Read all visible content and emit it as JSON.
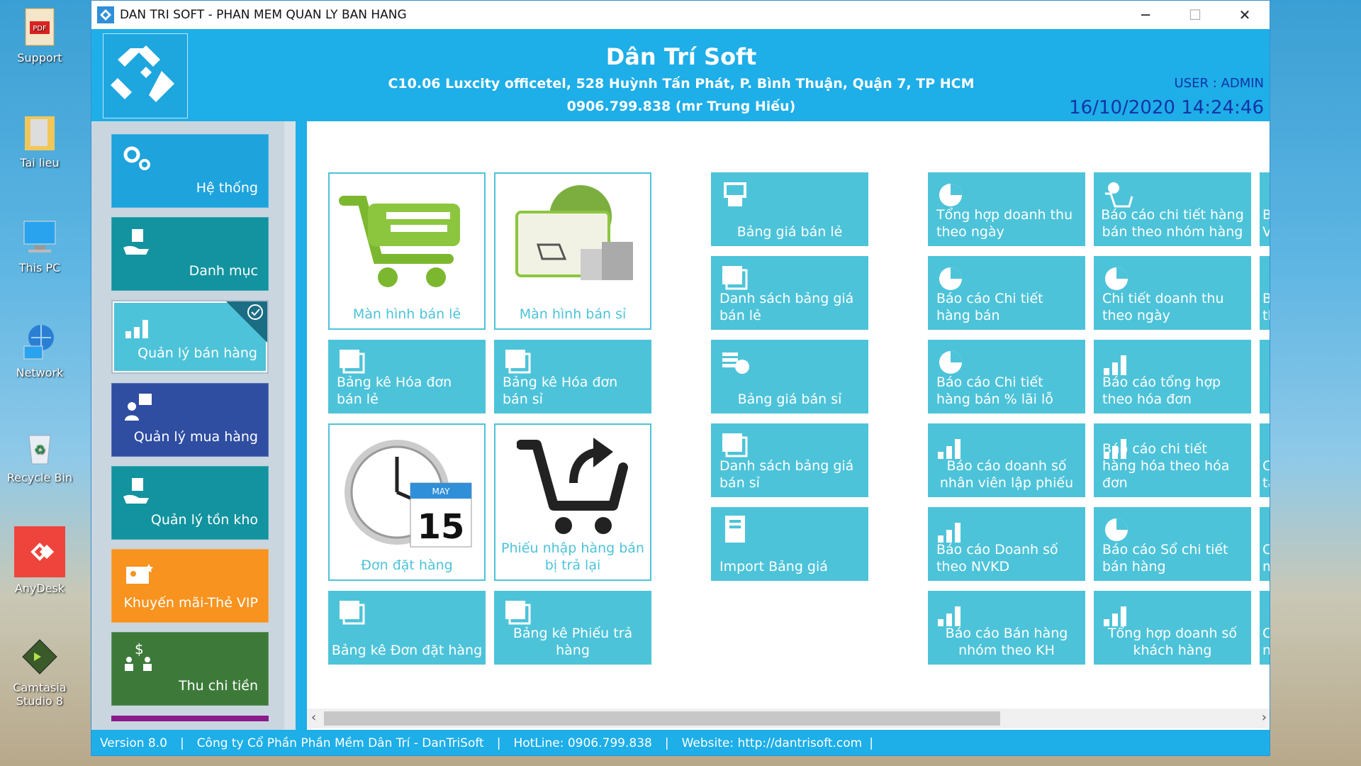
{
  "desktop": {
    "icons": [
      {
        "label": "Support",
        "icon": "pdf-file-icon"
      },
      {
        "label": "Tai lieu",
        "icon": "folder-icon"
      },
      {
        "label": "This PC",
        "icon": "computer-icon"
      },
      {
        "label": "Network",
        "icon": "network-icon"
      },
      {
        "label": "Recycle Bin",
        "icon": "recycle-bin-icon"
      },
      {
        "label": "AnyDesk",
        "icon": "anydesk-icon"
      },
      {
        "label": "Camtasia Studio 8",
        "icon": "camtasia-icon"
      }
    ]
  },
  "window": {
    "title": "DAN TRI SOFT - PHAN MEM QUAN LY BAN HANG",
    "minimize": "─",
    "maximize": "☐",
    "close": "✕"
  },
  "header": {
    "company": "Dân Trí Soft",
    "address": "C10.06 Luxcity officetel, 528 Huỳnh Tấn Phát, P. Bình Thuận, Quận 7, TP HCM",
    "phone": "0906.799.838 (mr Trung Hiếu)",
    "user": "USER : ADMIN",
    "datetime": "16/10/2020 14:24:46"
  },
  "sidebar": {
    "items": [
      {
        "label": "Hệ thống",
        "color": "#1ea3dc",
        "icon": "gears-icon"
      },
      {
        "label": "Danh mục",
        "color": "#12939f",
        "icon": "hand-box-icon"
      },
      {
        "label": "Quản lý bán hàng",
        "color": "#4dc3d9",
        "icon": "bar-chart-icon",
        "selected": true
      },
      {
        "label": "Quản lý mua hàng",
        "color": "#2f4ea2",
        "icon": "buyer-icon"
      },
      {
        "label": "Quản lý tồn kho",
        "color": "#12939f",
        "icon": "hand-box-icon"
      },
      {
        "label": "Khuyến mãi-Thẻ VIP",
        "color": "#f7931e",
        "icon": "vip-card-icon"
      },
      {
        "label": "Thu chi tiền",
        "color": "#3d7a3a",
        "icon": "money-transfer-icon"
      }
    ]
  },
  "tiles": {
    "col1": [
      {
        "label": "Màn hình bán lẻ",
        "icon": "shopping-cart-icon"
      },
      {
        "label": "Bảng kê Hóa đơn bán lẻ",
        "icon": "documents-icon"
      },
      {
        "label": "Đơn đặt hàng",
        "icon": "clock-calendar-icon"
      },
      {
        "label": "Bảng kê Đơn đặt hàng",
        "icon": "documents-icon"
      }
    ],
    "col2": [
      {
        "label": "Màn hình bán sỉ",
        "icon": "globe-shopping-icon"
      },
      {
        "label": "Bảng kê Hóa đơn bán sỉ",
        "icon": "documents-icon"
      },
      {
        "label": "Phiếu nhập hàng bán bị trả lại",
        "icon": "cart-return-icon"
      },
      {
        "label": "Bảng kê Phiếu trả hàng",
        "icon": "documents-icon"
      }
    ],
    "col3": [
      {
        "label": "Bảng giá bán lẻ",
        "icon": "price-terminal-icon"
      },
      {
        "label": "Danh sách bảng giá bán lẻ",
        "icon": "documents-icon"
      },
      {
        "label": "Bảng giá bán sỉ",
        "icon": "coins-icon"
      },
      {
        "label": "Danh sách bảng giá bán sỉ",
        "icon": "documents-icon"
      },
      {
        "label": "Import Bảng giá",
        "icon": "notebook-icon"
      }
    ],
    "col4": [
      {
        "label": "Tổng hợp doanh thu theo ngày",
        "icon": "pie-chart-icon"
      },
      {
        "label": "Báo cáo Chi tiết hàng bán",
        "icon": "pie-chart-icon"
      },
      {
        "label": "Báo cáo Chi tiết hàng bán % lãi lỗ",
        "icon": "pie-chart-icon"
      },
      {
        "label": "Báo cáo doanh số nhân viên lập phiếu",
        "icon": "bar-chart-icon"
      },
      {
        "label": "Báo cáo Doanh số theo NVKD",
        "icon": "bar-chart-icon"
      },
      {
        "label": "Báo cáo Bán hàng nhóm theo KH",
        "icon": "bar-chart-icon"
      }
    ],
    "col5": [
      {
        "label": "Báo cáo chi tiết hàng bán theo nhóm hàng",
        "icon": "cart-person-icon"
      },
      {
        "label": "Chi tiết doanh thu theo ngày",
        "icon": "pie-chart-icon"
      },
      {
        "label": "Báo cáo tổng hợp theo hóa đơn",
        "icon": "bar-chart-icon"
      },
      {
        "label": "Báo cáo chi tiết hàng hóa theo hóa đơn",
        "icon": "bar-chart-icon"
      },
      {
        "label": "Báo cáo Sổ chi tiết bán hàng",
        "icon": "pie-chart-icon"
      },
      {
        "label": "Tổng hợp doanh số khách hàng",
        "icon": "bar-chart-icon"
      }
    ],
    "col6_partial": [
      {
        "label": "B\nV"
      },
      {
        "label": "B\nth"
      },
      {
        "label": ""
      },
      {
        "label": "C\nta"
      },
      {
        "label": "C\nm"
      },
      {
        "label": "C\nnl"
      }
    ]
  },
  "statusbar": {
    "version": "Version 8.0",
    "company": "Công ty Cổ Phần Phần Mềm Dân Trí - DanTriSoft",
    "hotline": "HotLine: 0906.799.838",
    "website": "Website: http://dantrisoft.com",
    "separator": "|"
  }
}
